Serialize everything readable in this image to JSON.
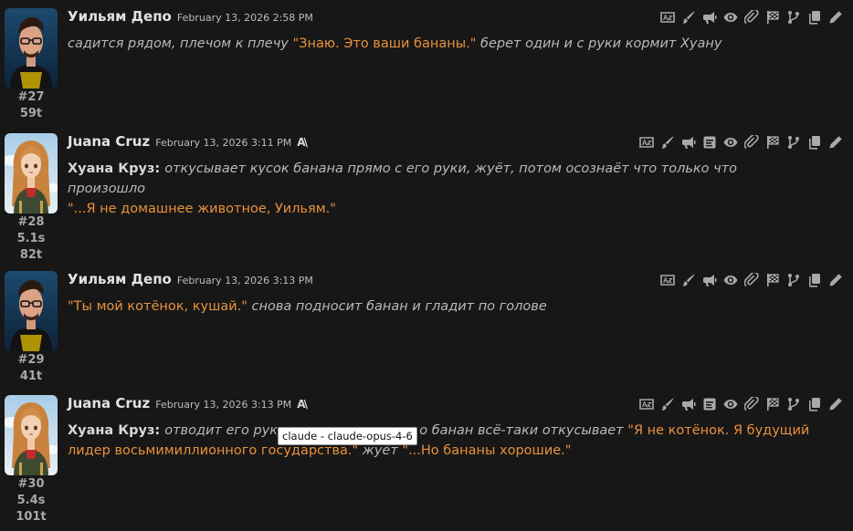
{
  "messages": [
    {
      "name": "Уильям Депо",
      "date": "February 13, 2026 2:58 PM",
      "id": "#27",
      "timer": "",
      "tokens": "59t",
      "avatar": "william",
      "model_icon": "",
      "segments": [
        {
          "type": "it",
          "text": "садится рядом, плечом к плечу "
        },
        {
          "type": "q",
          "text": "\"Знаю. Это ваши бананы.\""
        },
        {
          "type": "it",
          "text": " берет один и с руки кормит Хуану"
        }
      ]
    },
    {
      "name": "Juana Cruz",
      "date": "February 13, 2026 3:11 PM",
      "id": "#28",
      "timer": "5.1s",
      "tokens": "82t",
      "avatar": "juana",
      "model_icon": "A\\",
      "segments": [
        {
          "type": "speaker",
          "text": "Хуана Круз: "
        },
        {
          "type": "it",
          "text": "откусывает кусок банана прямо с его руки, жуёт, потом осознаёт что только что произошло"
        },
        {
          "type": "br",
          "text": ""
        },
        {
          "type": "q",
          "text": "\"...Я не домашнее животное, Уильям.\""
        }
      ]
    },
    {
      "name": "Уильям Депо",
      "date": "February 13, 2026 3:13 PM",
      "id": "#29",
      "timer": "",
      "tokens": "41t",
      "avatar": "william",
      "model_icon": "",
      "segments": [
        {
          "type": "q",
          "text": "\"Ты мой котёнок, кушай.\""
        },
        {
          "type": "it",
          "text": " снова подносит банан и гладит по голове"
        }
      ]
    },
    {
      "name": "Juana Cruz",
      "date": "February 13, 2026 3:13 PM",
      "id": "#30",
      "timer": "5.4s",
      "tokens": "101t",
      "avatar": "juana",
      "model_icon": "A\\",
      "segments": [
        {
          "type": "speaker",
          "text": "Хуана Круз: "
        },
        {
          "type": "it",
          "text": "отводит его руку "
        },
        {
          "type": "gap",
          "text": ""
        },
        {
          "type": "it",
          "text": "о банан всё-таки откусывает "
        },
        {
          "type": "q",
          "text": "\"Я не котёнок. Я будущий лидер восьмимиллионного государства.\""
        },
        {
          "type": "it",
          "text": " жуёт "
        },
        {
          "type": "q",
          "text": "\"...Но бананы хорошие.\""
        }
      ]
    }
  ],
  "tools_user": [
    "translate-icon",
    "paint-brush-icon",
    "megaphone-icon",
    "eye-icon",
    "paperclip-icon",
    "flag-icon",
    "branch-icon",
    "copy-icon",
    "pencil-icon"
  ],
  "tools_ai": [
    "translate-icon",
    "paint-brush-icon",
    "megaphone-icon",
    "summary-icon",
    "eye-icon",
    "paperclip-icon",
    "flag-icon",
    "branch-icon",
    "copy-icon",
    "pencil-icon"
  ],
  "tooltip": "claude - claude-opus-4-6",
  "colors": {
    "background": "#171717",
    "quote": "#e9913d",
    "italic": "#b9b9b9",
    "icon": "#a9a9a9"
  }
}
